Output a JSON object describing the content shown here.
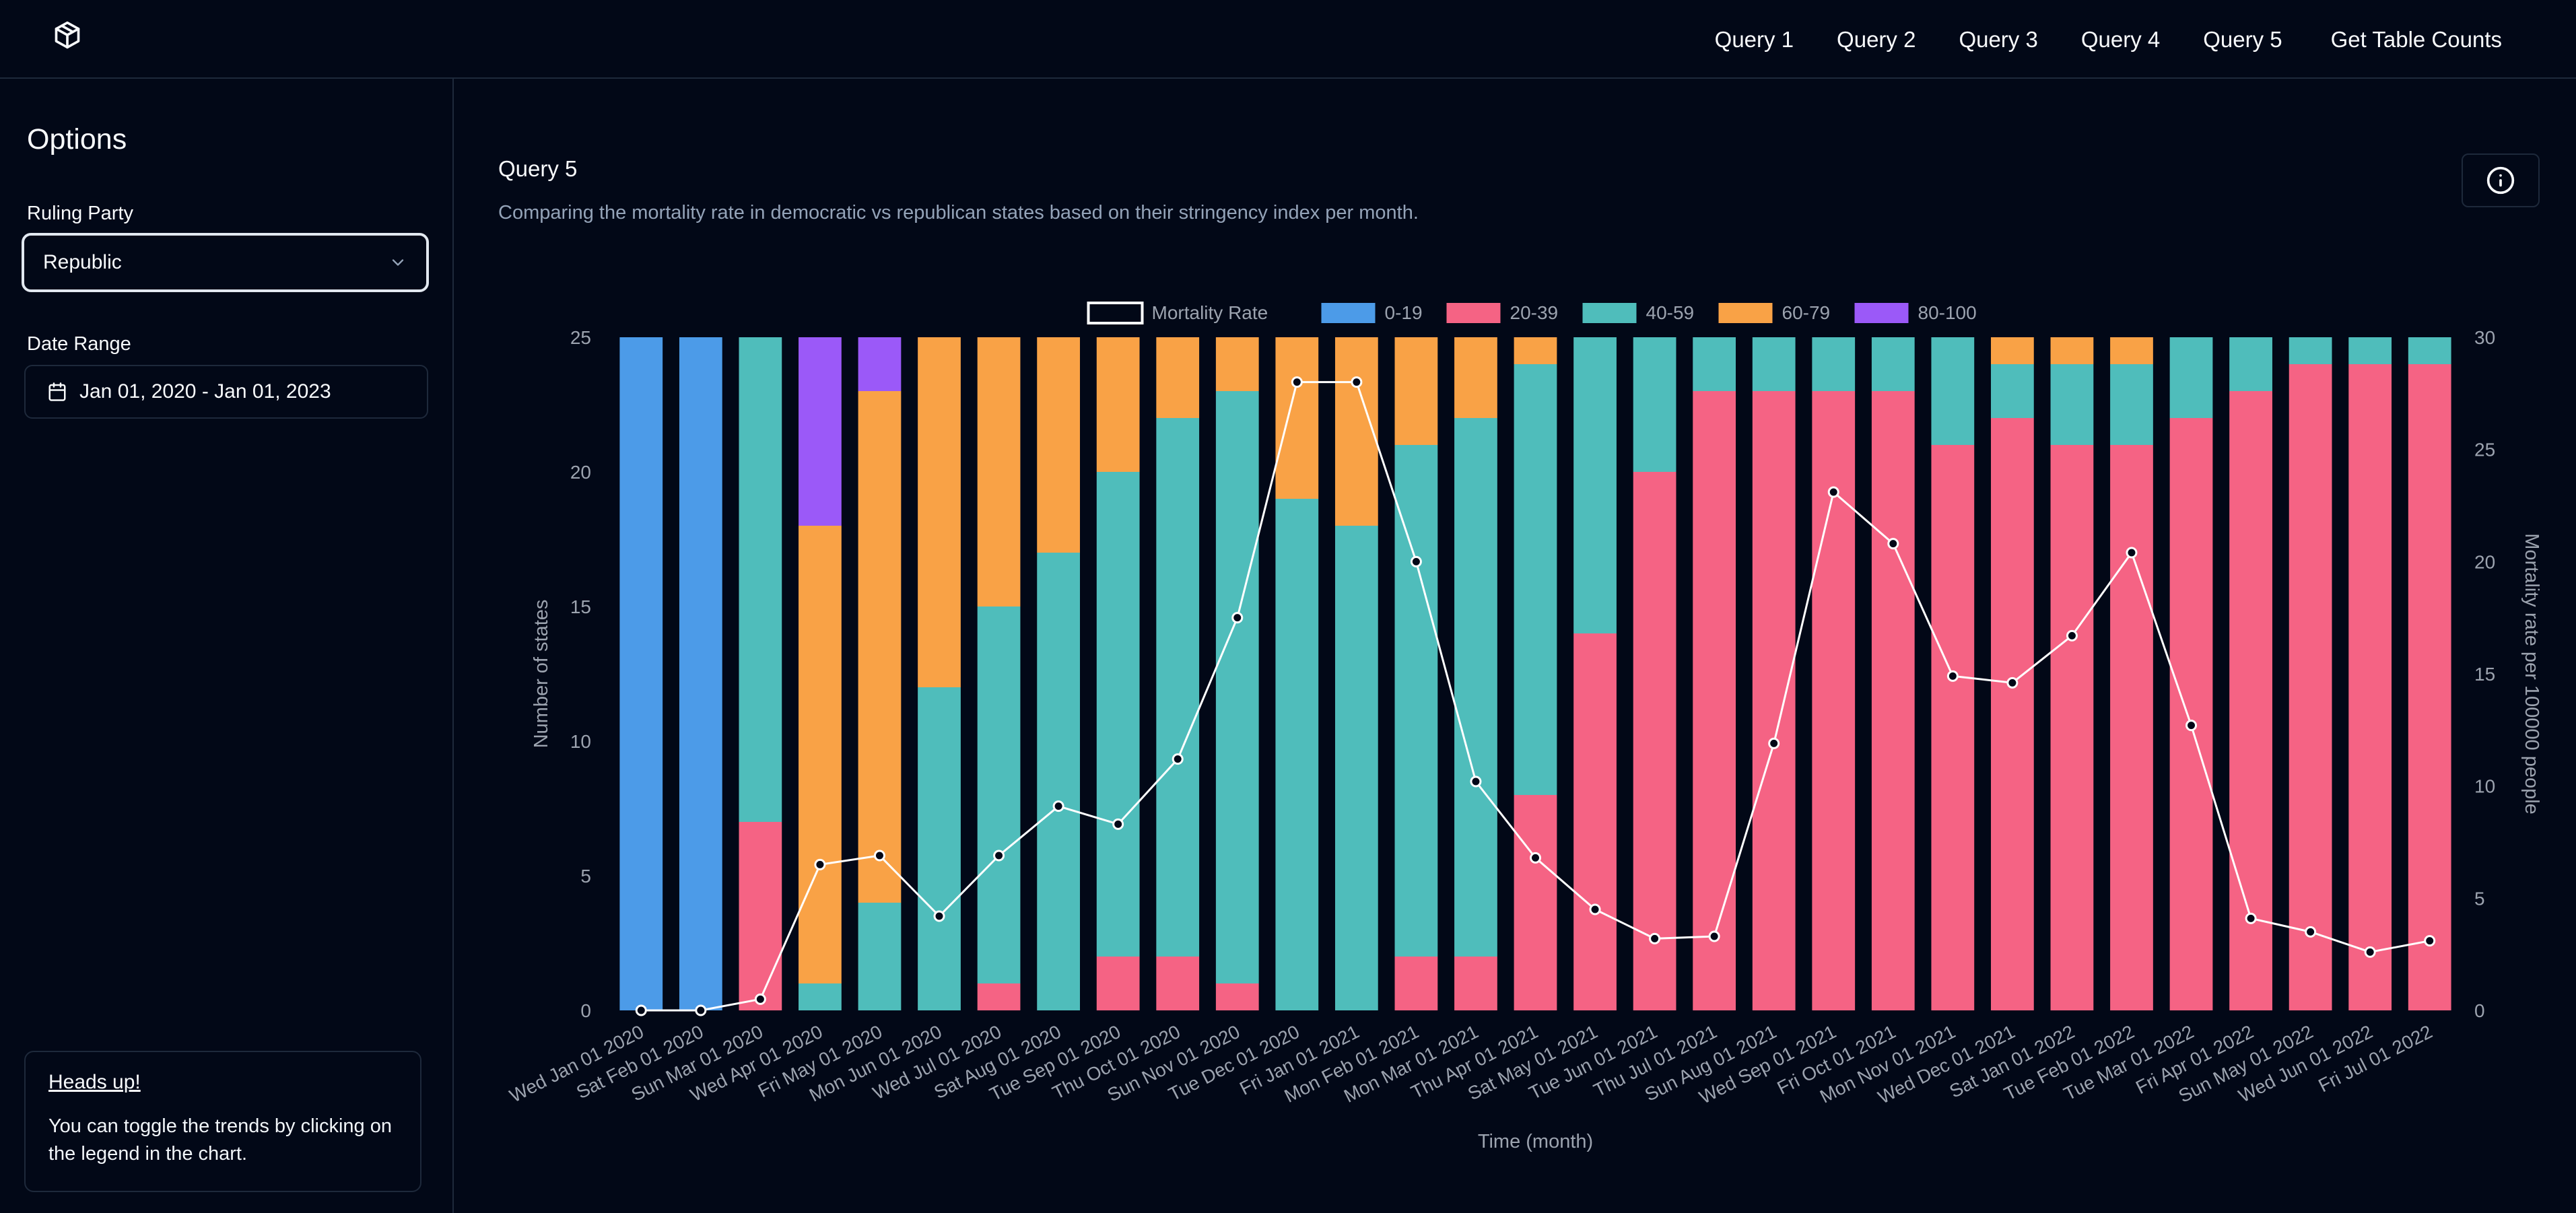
{
  "nav": {
    "items": [
      "Query 1",
      "Query 2",
      "Query 3",
      "Query 4",
      "Query 5"
    ],
    "table_counts": "Get Table Counts"
  },
  "sidebar": {
    "title": "Options",
    "ruling_party_label": "Ruling Party",
    "ruling_party_value": "Republic",
    "date_range_label": "Date Range",
    "date_range_value": "Jan 01, 2020 - Jan 01, 2023",
    "headsup_title": "Heads up!",
    "headsup_text": "You can toggle the trends by clicking on the legend in the chart."
  },
  "main": {
    "title": "Query 5",
    "description": "Comparing the mortality rate in democratic vs republican states based on their stringency index per month."
  },
  "chart_data": {
    "type": "bar",
    "stacked": true,
    "xlabel": "Time (month)",
    "ylabel": "Number of states",
    "y2label": "Mortality rate per 100000 people",
    "ylim": [
      0,
      25
    ],
    "y2lim": [
      0,
      30
    ],
    "yticks": [
      0,
      5,
      10,
      15,
      20,
      25
    ],
    "y2ticks": [
      0,
      5,
      10,
      15,
      20,
      25,
      30
    ],
    "legend_position": "top",
    "categories": [
      "Wed Jan 01 2020",
      "Sat Feb 01 2020",
      "Sun Mar 01 2020",
      "Wed Apr 01 2020",
      "Fri May 01 2020",
      "Mon Jun 01 2020",
      "Wed Jul 01 2020",
      "Sat Aug 01 2020",
      "Tue Sep 01 2020",
      "Thu Oct 01 2020",
      "Sun Nov 01 2020",
      "Tue Dec 01 2020",
      "Fri Jan 01 2021",
      "Mon Feb 01 2021",
      "Mon Mar 01 2021",
      "Thu Apr 01 2021",
      "Sat May 01 2021",
      "Tue Jun 01 2021",
      "Thu Jul 01 2021",
      "Sun Aug 01 2021",
      "Wed Sep 01 2021",
      "Fri Oct 01 2021",
      "Mon Nov 01 2021",
      "Wed Dec 01 2021",
      "Sat Jan 01 2022",
      "Tue Feb 01 2022",
      "Tue Mar 01 2022",
      "Fri Apr 01 2022",
      "Sun May 01 2022",
      "Wed Jun 01 2022",
      "Fri Jul 01 2022"
    ],
    "series": [
      {
        "name": "0-19",
        "color": "#4c9be8",
        "values": [
          25,
          25,
          0,
          0,
          0,
          0,
          0,
          0,
          0,
          0,
          0,
          0,
          0,
          0,
          0,
          0,
          0,
          0,
          0,
          0,
          0,
          0,
          0,
          0,
          0,
          0,
          0,
          0,
          0,
          0,
          0
        ]
      },
      {
        "name": "20-39",
        "color": "#f56384",
        "values": [
          0,
          0,
          7,
          0,
          0,
          0,
          1,
          0,
          2,
          2,
          1,
          0,
          0,
          2,
          2,
          8,
          14,
          20,
          23,
          23,
          23,
          23,
          21,
          22,
          21,
          21,
          22,
          23,
          24,
          24,
          24
        ]
      },
      {
        "name": "40-59",
        "color": "#4fbdbb",
        "values": [
          0,
          0,
          18,
          1,
          4,
          12,
          14,
          17,
          18,
          20,
          22,
          19,
          18,
          19,
          20,
          16,
          11,
          5,
          2,
          2,
          2,
          2,
          4,
          2,
          3,
          3,
          3,
          2,
          1,
          1,
          1
        ]
      },
      {
        "name": "60-79",
        "color": "#f9a246",
        "values": [
          0,
          0,
          0,
          17,
          19,
          13,
          10,
          8,
          5,
          3,
          2,
          6,
          7,
          4,
          3,
          1,
          0,
          0,
          0,
          0,
          0,
          0,
          0,
          1,
          1,
          1,
          0,
          0,
          0,
          0,
          0
        ]
      },
      {
        "name": "80-100",
        "color": "#9b59f8",
        "values": [
          0,
          0,
          0,
          7,
          2,
          0,
          0,
          0,
          0,
          0,
          0,
          0,
          0,
          0,
          0,
          0,
          0,
          0,
          0,
          0,
          0,
          0,
          0,
          0,
          0,
          0,
          0,
          0,
          0,
          0,
          0
        ]
      }
    ],
    "line": {
      "name": "Mortality Rate",
      "color": "#ffffff",
      "values": [
        0,
        0,
        0.5,
        6.5,
        6.9,
        4.2,
        6.9,
        9.1,
        8.3,
        11.2,
        17.5,
        28,
        28,
        20,
        10.2,
        6.8,
        4.5,
        3.2,
        3.3,
        11.9,
        23.1,
        20.8,
        14.9,
        14.6,
        16.7,
        20.4,
        12.7,
        4.1,
        3.5,
        2.6,
        3.1
      ]
    }
  }
}
